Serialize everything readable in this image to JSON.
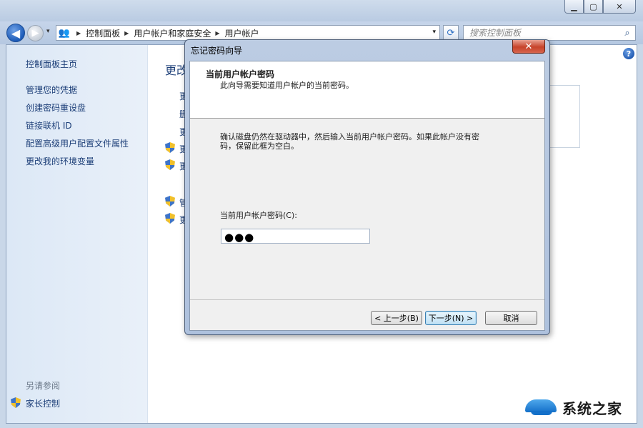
{
  "window": {
    "caption": {
      "min": "▁",
      "max": "▢",
      "close": "✕"
    }
  },
  "nav": {
    "back": "◀",
    "forward": "▶",
    "history": "▾",
    "breadcrumbs": [
      "控制面板",
      "用户帐户和家庭安全",
      "用户帐户"
    ],
    "dropdown": "▾",
    "refresh": "⟳",
    "search_placeholder": "搜索控制面板"
  },
  "sidebar": {
    "home": "控制面板主页",
    "items": [
      "管理您的凭据",
      "创建密码重设盘",
      "链接联机 ID",
      "配置高级用户配置文件属性",
      "更改我的环境变量"
    ],
    "see_also": "另请参阅",
    "see_also_link": "家长控制"
  },
  "main": {
    "heading_partial": "更改",
    "partial_links": [
      "更",
      "删",
      "更",
      "更",
      "更",
      "管",
      "更"
    ],
    "help": "?"
  },
  "dialog": {
    "title": "忘记密码向导",
    "close": "✕",
    "header_title": "当前用户帐户密码",
    "header_sub": "此向导需要知道用户帐户的当前密码。",
    "description": "确认磁盘仍然在驱动器中，然后输入当前用户帐户密码。如果此帐户没有密码，保留此框为空白。",
    "password_label": "当前用户帐户密码(C):",
    "password_value": "●●●",
    "buttons": {
      "back": "< 上一步(B)",
      "next": "下一步(N) >",
      "cancel": "取消"
    }
  },
  "watermark": {
    "text": "系统之家"
  }
}
